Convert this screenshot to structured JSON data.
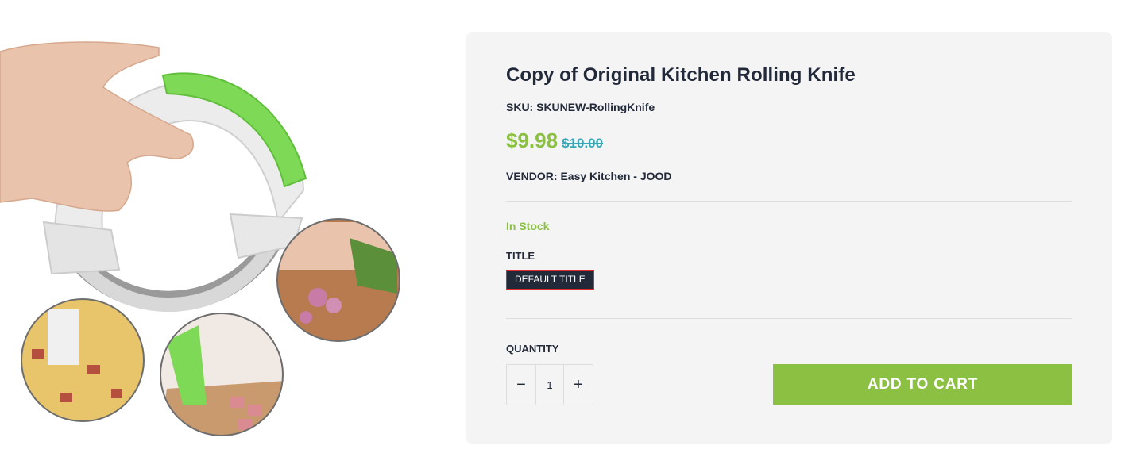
{
  "product": {
    "title": "Copy of Original Kitchen Rolling Knife",
    "sku": "SKU: SKUNEW-RollingKnife",
    "price": "$9.98",
    "compare_price": "$10.00",
    "vendor": "VENDOR: Easy Kitchen - JOOD",
    "stock_status": "In Stock",
    "option_label": "TITLE",
    "option_value": "DEFAULT TITLE",
    "quantity_label": "QUANTITY",
    "quantity_value": "1",
    "decrement_icon": "−",
    "increment_icon": "+",
    "add_to_cart_label": "ADD TO CART"
  },
  "colors": {
    "accent_green": "#8bc043",
    "compare_price": "#3aa7b8",
    "text_dark": "#222a3a",
    "card_bg": "#f4f4f4"
  },
  "icons": {
    "decrement": "minus-icon",
    "increment": "plus-icon"
  }
}
